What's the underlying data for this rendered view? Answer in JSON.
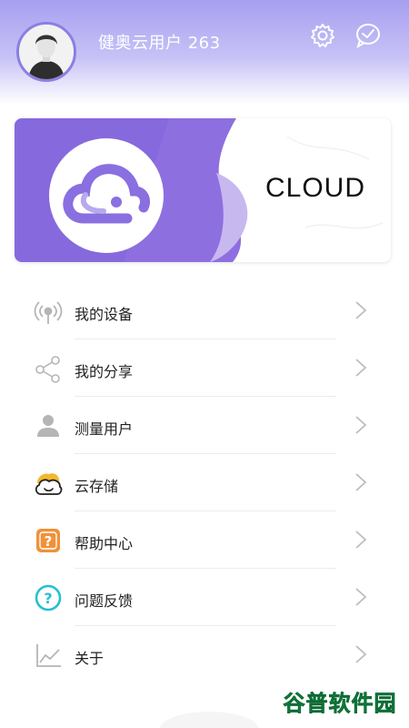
{
  "header": {
    "username": "健奥云用户 263",
    "settings_icon": "gear-icon",
    "message_icon": "message-bubble-icon"
  },
  "banner": {
    "text": "CLOUD",
    "logo_icon": "cloud-logo-icon"
  },
  "menu": {
    "items": [
      {
        "label": "我的设备",
        "icon": "device-signal-icon"
      },
      {
        "label": "我的分享",
        "icon": "share-icon"
      },
      {
        "label": "测量用户",
        "icon": "user-icon"
      },
      {
        "label": "云存储",
        "icon": "cloud-storage-icon"
      },
      {
        "label": "帮助中心",
        "icon": "help-icon"
      },
      {
        "label": "问题反馈",
        "icon": "feedback-question-icon"
      },
      {
        "label": "关于",
        "icon": "chart-line-icon"
      }
    ]
  },
  "watermark": {
    "text": "谷普软件园"
  },
  "colors": {
    "accent": "#8a7fe3",
    "accent_light": "#c7c2f6",
    "help_orange": "#f0913a",
    "feedback_cyan": "#26c0d0",
    "cloud_yellow": "#f5b92e",
    "watermark_green": "#1aa152"
  }
}
